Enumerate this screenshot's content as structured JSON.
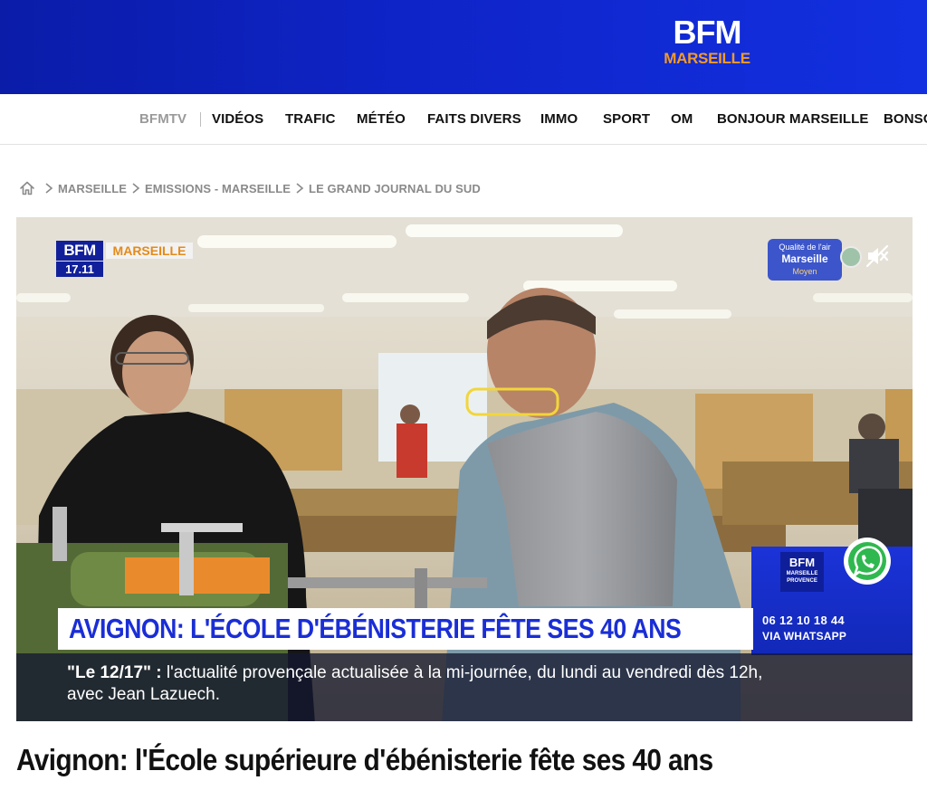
{
  "brand": {
    "logo_top": "BFM",
    "logo_city": "MARSEILLE",
    "header_color": "#0f24c8",
    "accent_color": "#f19a2a"
  },
  "nav": {
    "items": [
      "BFMTV",
      "VIDÉOS",
      "TRAFIC",
      "MÉTÉO",
      "FAITS DIVERS",
      "IMMO",
      "SPORT",
      "OM",
      "BONJOUR MARSEILLE",
      "BONSO"
    ]
  },
  "breadcrumb": {
    "home_icon": "home-icon",
    "items": [
      "MARSEILLE",
      "EMISSIONS - MARSEILLE",
      "LE GRAND JOURNAL DU SUD"
    ]
  },
  "video": {
    "channel_logo": "BFM",
    "channel_city": "MARSEILLE",
    "time": "17.11",
    "air_quality": {
      "line1": "Qualité de l'air",
      "line2": "Marseille",
      "line3": "Moyen"
    },
    "mute_icon": "muted-speaker-icon",
    "promo": {
      "logo_line1": "BFM",
      "logo_line2": "MARSEILLE",
      "logo_line3": "PROVENCE",
      "phone": "06 12 10 18 44",
      "via": "VIA WHATSAPP",
      "icon": "whatsapp-icon"
    },
    "headline": "AVIGNON: L'ÉCOLE D'ÉBÉNISTERIE FÊTE SES 40 ANS",
    "ticker_show": "\"Le 12/17\" :",
    "ticker_text": "l'actualité provençale actualisée à la mi-journée, du lundi au vendredi dès 12h, avec Jean Lazuech."
  },
  "article": {
    "title": "Avignon: l'École supérieure d'ébénisterie fête ses 40 ans"
  }
}
